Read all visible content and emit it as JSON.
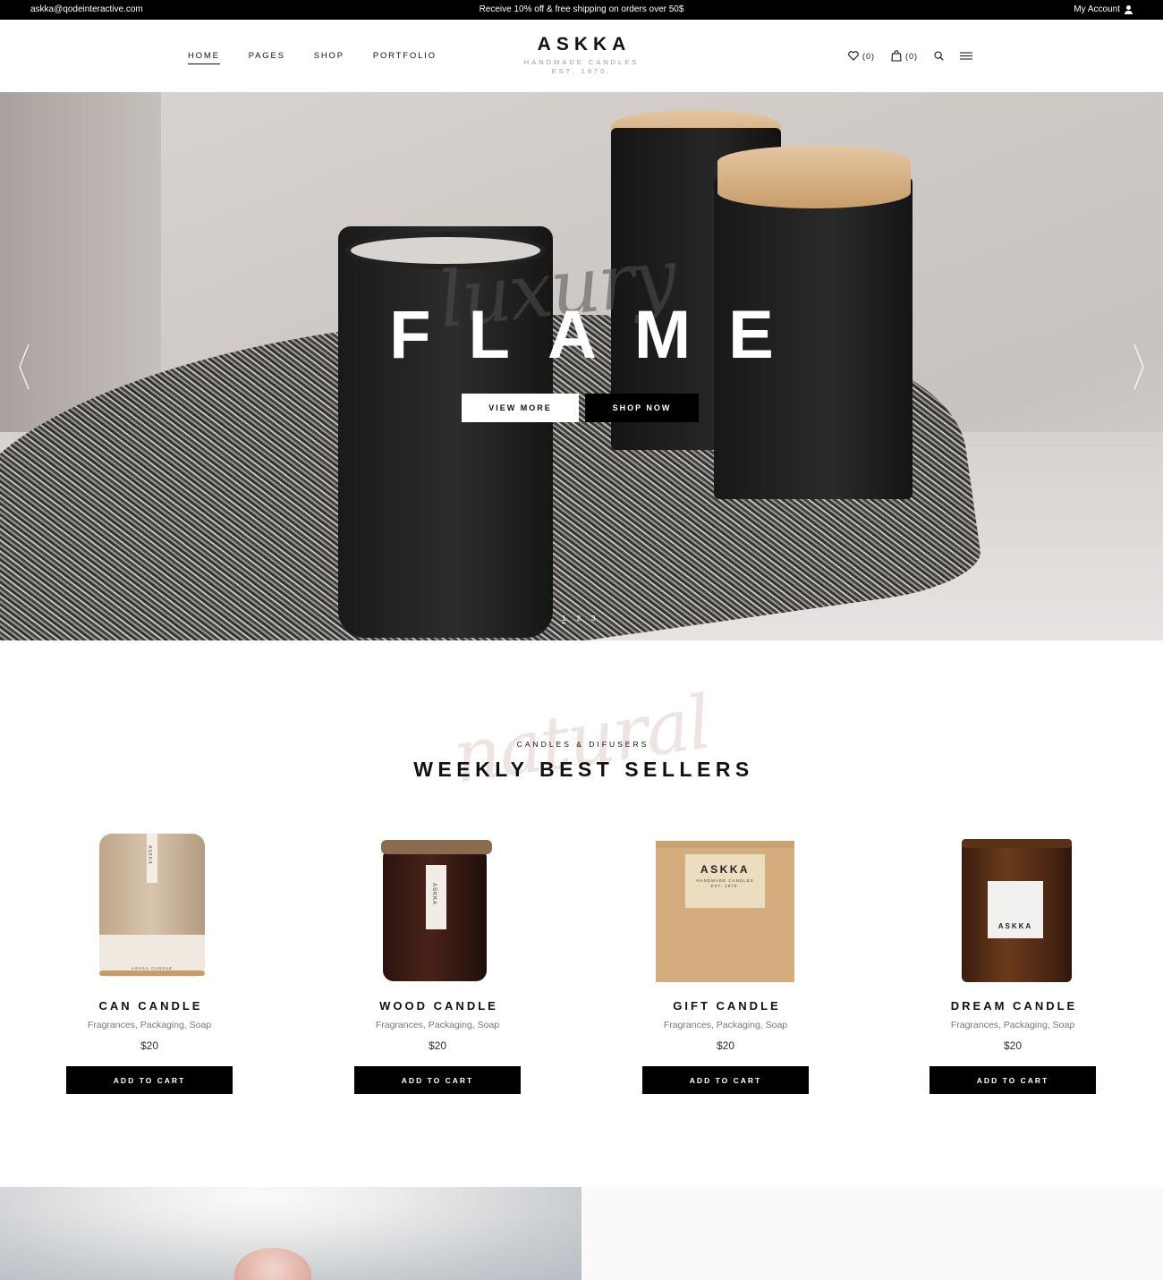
{
  "topbar": {
    "email": "askka@qodeinteractive.com",
    "promo": "Receive 10% off & free shipping on orders over 50$",
    "account": "My Account"
  },
  "nav": {
    "items": [
      "HOME",
      "PAGES",
      "SHOP",
      "PORTFOLIO"
    ]
  },
  "logo": {
    "name": "ASKKA",
    "tagline": "HANDMADE CANDLES",
    "est": "EST. 1970."
  },
  "header_icons": {
    "wishlist_count": "(0)",
    "cart_count": "(0)"
  },
  "hero": {
    "headline": "FLAME",
    "script_word": "luxury",
    "view_more": "VIEW MORE",
    "shop_now": "SHOP NOW",
    "slides": [
      "1",
      "2",
      "3"
    ],
    "active_slide": 1
  },
  "bestsellers": {
    "script_word": "natural",
    "kicker": "CANDLES & DIFUSERS",
    "heading": "WEEKLY BEST SELLERS",
    "products": [
      {
        "name": "CAN CANDLE",
        "tags": "Fragrances, Packaging, Soap",
        "price": "$20",
        "cta": "ADD TO CART",
        "label": "ASKKA",
        "label_sub": "ASKKA CANDLE"
      },
      {
        "name": "WOOD CANDLE",
        "tags": "Fragrances, Packaging, Soap",
        "price": "$20",
        "cta": "ADD TO CART",
        "label": "ASKKA"
      },
      {
        "name": "GIFT CANDLE",
        "tags": "Fragrances, Packaging, Soap",
        "price": "$20",
        "cta": "ADD TO CART",
        "label": "ASKKA",
        "label_sub": "HANDMADE CANDLES",
        "label_est": "EST. 1970."
      },
      {
        "name": "DREAM CANDLE",
        "tags": "Fragrances, Packaging, Soap",
        "price": "$20",
        "cta": "ADD TO CART",
        "label": "ASKKA"
      }
    ]
  },
  "colors": {
    "accent": "#000000",
    "background": "#ffffff",
    "muted_text": "#777777",
    "script_pink": "#ceb2aa"
  }
}
